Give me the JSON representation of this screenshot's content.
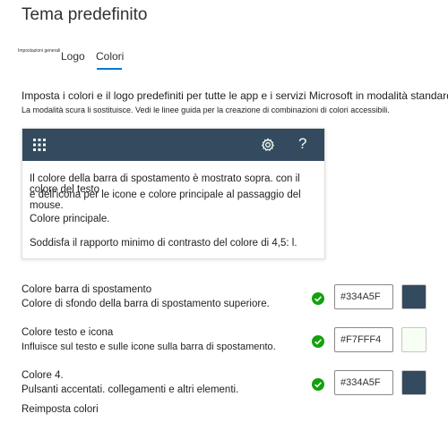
{
  "page": {
    "title": "Tema predefinito"
  },
  "tabs": {
    "general": "Impostazioni generali",
    "logo": "Logo",
    "colors": "Colori"
  },
  "description": {
    "line1": "Imposta i colori e il logo predefiniti per tutte le app e i servizi Microsoft in modalità standard.",
    "line2": "La modalità scura li sostituisce. Vedi le linee guida per la creazione di combinazioni di colori accessibili."
  },
  "preview": {
    "bar_color": "#334A5F",
    "icon_color": "#F7FFF4",
    "icons": {
      "left": "waffle-icon",
      "settings": "gear-icon",
      "help": "help-icon"
    },
    "help_glyph": "?",
    "line1": "Il colore della barra di spostamento è mostrato sopra. con il colore del testo",
    "line2": "e dell'icona per le icone e colore principale al passaggio del mouse.",
    "line3": "Colore principale.",
    "line4": "Soddisfa il rapporto minimo di contrasto del colore di 4,5: l."
  },
  "color_settings": [
    {
      "title": "Colore barra di spostamento",
      "description": "Colore di sfondo della barra di spostamento superiore.",
      "value": "#334A5F",
      "swatch": "#334A5F",
      "status_icon": "check-circle-icon"
    },
    {
      "title": "Colore testo e icona",
      "description": "Influisce sul testo e sulle icone sulla barra di spostamento.",
      "value": "#F7FFF4",
      "swatch": "#F7FFF4",
      "status_icon": "check-circle-icon"
    },
    {
      "title": "Colore 4.",
      "description": "Pulsanti accentati. collegamenti e altri elementi.",
      "value": "#334A5F",
      "swatch": "#334A5F",
      "status_icon": "check-circle-icon"
    }
  ],
  "status_color": "#13a10e",
  "reset_label": "Reimposta colori"
}
